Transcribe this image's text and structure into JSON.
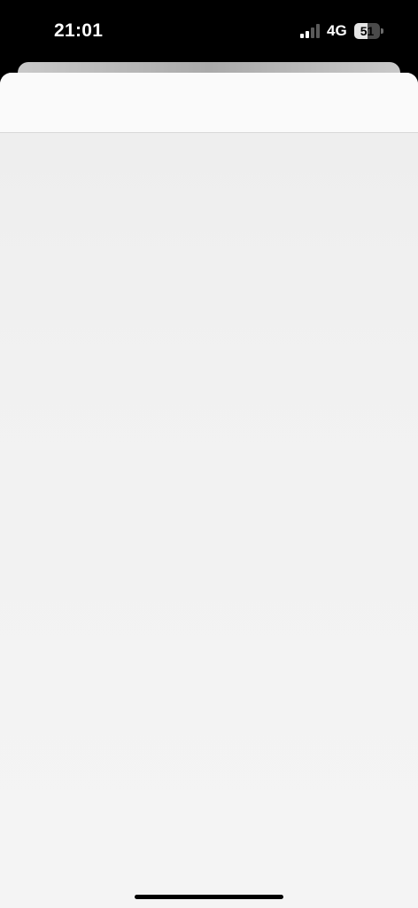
{
  "status_bar": {
    "time": "21:01",
    "network": "4G",
    "battery_percent": "51",
    "battery_level": 0.51,
    "signal_bars_filled": 2,
    "signal_bars_total": 4
  },
  "icons": {
    "signal": "cellular-signal-icon",
    "battery": "battery-icon"
  },
  "colors": {
    "status_bar_bg": "#000000",
    "sheet_bg": "#f2f2f2",
    "header_bg": "#fafafa"
  }
}
